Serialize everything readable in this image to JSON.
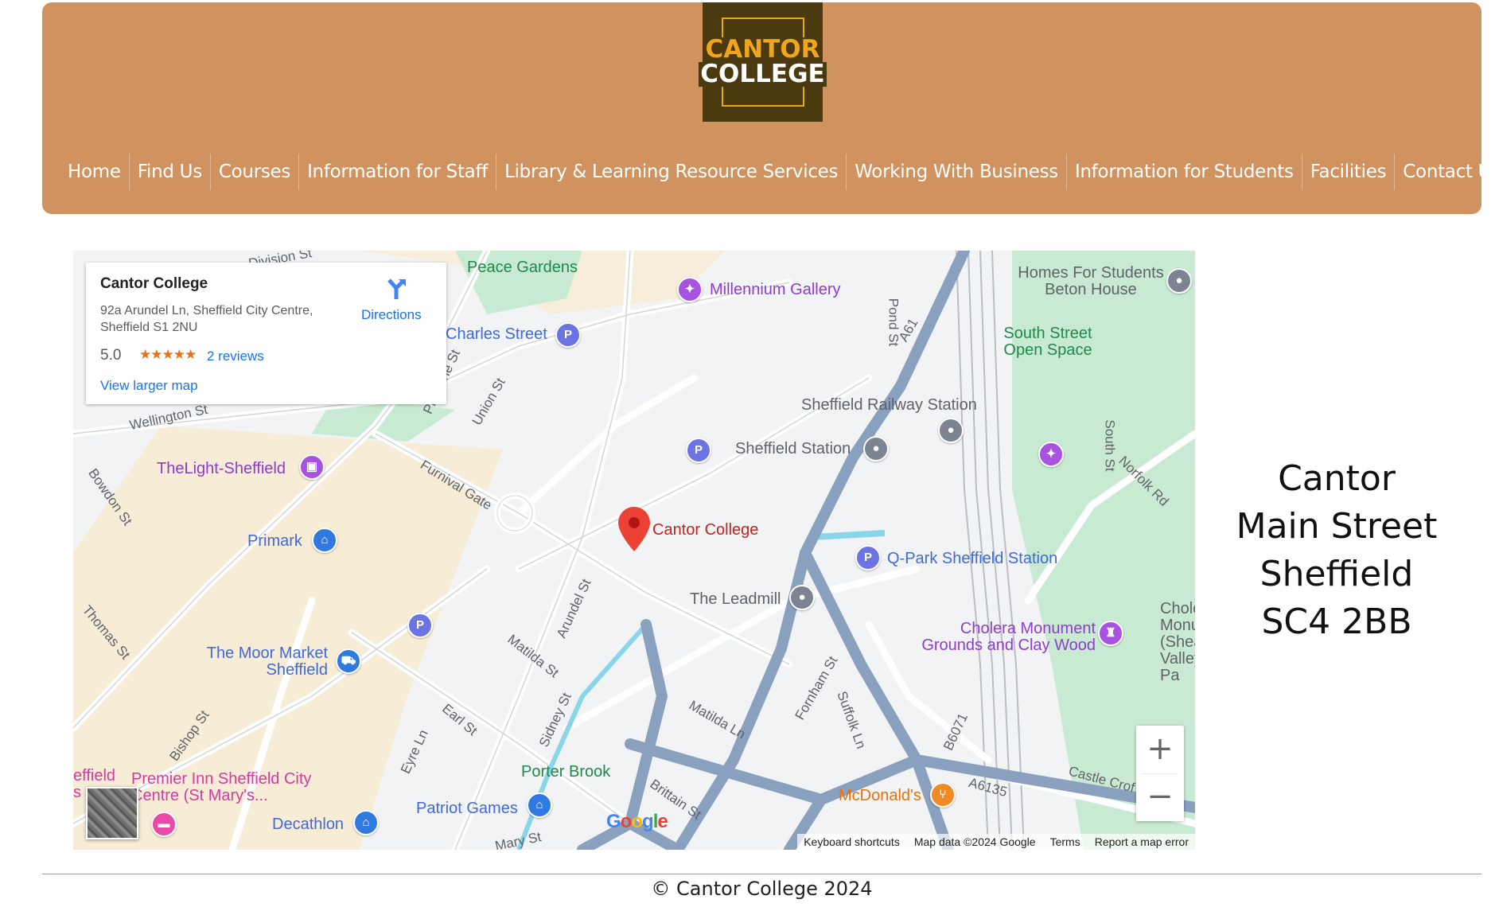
{
  "logo": {
    "line1": "CANTOR",
    "line2": "COLLEGE"
  },
  "nav": [
    "Home",
    "Find Us",
    "Courses",
    "Information for Staff",
    "Library & Learning Resource Services",
    "Working With Business",
    "Information for Students",
    "Facilities",
    "Contact Us"
  ],
  "map": {
    "card": {
      "title": "Cantor College",
      "address": "92a Arundel Ln, Sheffield City Centre, Sheffield S1 2NU",
      "rating": "5.0",
      "stars": "★★★★★",
      "reviews": "2 reviews",
      "larger_map": "View larger map",
      "directions": "Directions"
    },
    "marker_label": "Cantor College",
    "places": {
      "peace_gardens": "Peace Gardens",
      "millennium_gallery": "Millennium Gallery",
      "charles_street": "Charles Street",
      "homes_for_students": "Homes For Students Beton House",
      "south_street_open_space": "South Street Open Space",
      "sheffield_railway_station": "Sheffield Railway Station",
      "sheffield_station": "Sheffield Station",
      "thelight": "TheLight-Sheffield",
      "primark": "Primark",
      "q_park": "Q-Park Sheffield Station",
      "leadmill": "The Leadmill",
      "cholera_monument": "Cholera Monument Grounds and Clay Wood",
      "cholera_partial": "Choler Monum (Shea Valley Pa",
      "moor_market": "The Moor Market Sheffield",
      "premier_inn": "Premier Inn Sheffield City Centre (St Mary's...",
      "effield_partial": "effield s",
      "porter_brook": "Porter Brook",
      "patriot_games": "Patriot Games",
      "decathlon": "Decathlon",
      "mcdonalds": "McDonald's"
    },
    "streets": {
      "division_st": "Division St",
      "pond_st": "Pond St",
      "a61": "A61",
      "union_st": "Union St",
      "pinstone_st": "Pinstone St",
      "wellington_st": "Wellington St",
      "furnival_gate": "Furnival Gate",
      "bowdon_st": "Bowdon St",
      "south_st": "South St",
      "norfolk_rd": "Norfolk Rd",
      "arundel_st": "Arundel St",
      "matilda_st": "Matilda St",
      "thomas_st": "Thomas St",
      "earl_st": "Earl St",
      "sidney_st": "Sidney St",
      "matilda_ln": "Matilda Ln",
      "fornham_st": "Fornham St",
      "suffolk_ln": "Suffolk Ln",
      "b6071": "B6071",
      "castle_cro": "Castle Crof",
      "a6135": "A6135",
      "bishop_st": "Bishop St",
      "eyre_ln": "Eyre Ln",
      "brittain_st": "Brittain St",
      "mary_st": "Mary St"
    },
    "google": "Google",
    "attribution": {
      "shortcuts": "Keyboard shortcuts",
      "data": "Map data ©2024 Google",
      "terms": "Terms",
      "report": "Report a map error"
    },
    "zoom_in": "+",
    "zoom_out": "−"
  },
  "address_lines": [
    "Cantor",
    "Main Street",
    "Sheffield",
    "SC4 2BB"
  ],
  "footer": "© Cantor College 2024",
  "colors": {
    "header": "#d0935f",
    "logo_bg": "#4b3a10",
    "logo_accent": "#f0a51a",
    "link": "#1a73e8",
    "marker": "#ea4335"
  }
}
